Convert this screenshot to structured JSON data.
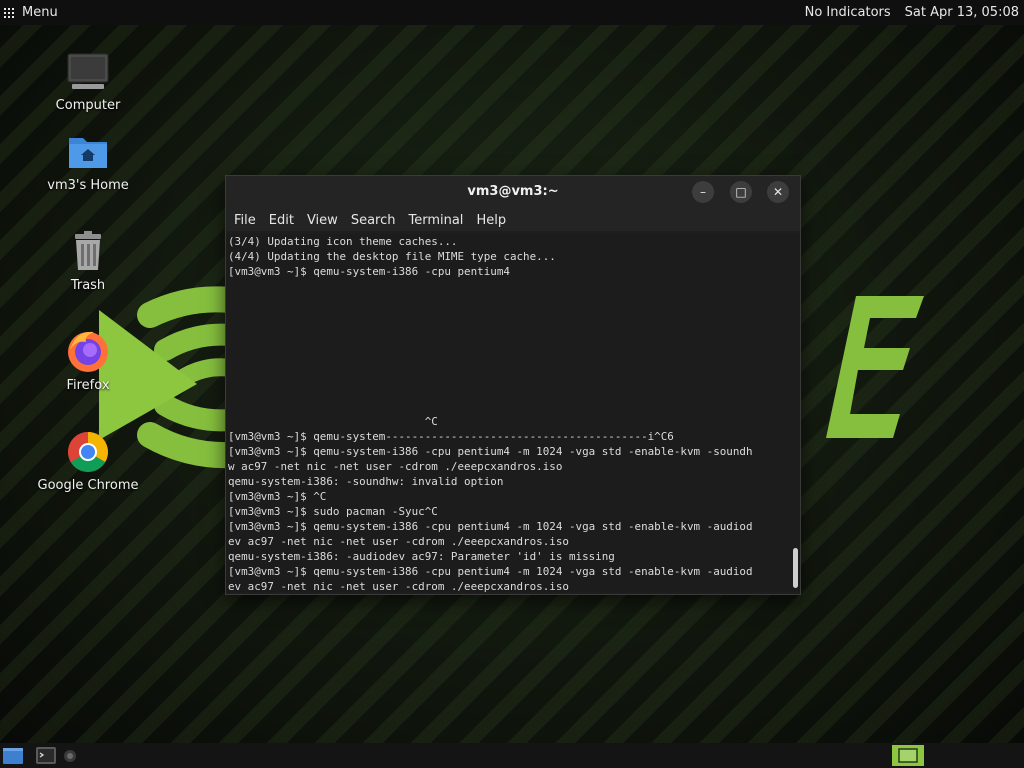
{
  "top_panel": {
    "menu_label": "Menu",
    "indicators": "No Indicators",
    "clock": "Sat Apr 13, 05:08"
  },
  "desktop": {
    "icons": [
      {
        "label": "Computer",
        "icon": "computer-icon"
      },
      {
        "label": "vm3's Home",
        "icon": "home-folder-icon"
      },
      {
        "label": "Trash",
        "icon": "trash-icon"
      },
      {
        "label": "Firefox",
        "icon": "firefox-icon"
      },
      {
        "label": "Google Chrome",
        "icon": "chrome-icon"
      }
    ]
  },
  "terminal": {
    "title": "vm3@vm3:~",
    "controls": {
      "minimize": "–",
      "maximize": "□",
      "close": "✕"
    },
    "menu": [
      "File",
      "Edit",
      "View",
      "Search",
      "Terminal",
      "Help"
    ],
    "lines": [
      "(3/4) Updating icon theme caches...",
      "(4/4) Updating the desktop file MIME type cache...",
      "[vm3@vm3 ~]$ qemu-system-i386 -cpu pentium4",
      "",
      "",
      "",
      "",
      "",
      "",
      "",
      "",
      "",
      "                              ^C",
      "[vm3@vm3 ~]$ qemu-system----------------------------------------i^C6",
      "[vm3@vm3 ~]$ qemu-system-i386 -cpu pentium4 -m 1024 -vga std -enable-kvm -soundh",
      "w ac97 -net nic -net user -cdrom ./eeepcxandros.iso",
      "qemu-system-i386: -soundhw: invalid option",
      "[vm3@vm3 ~]$ ^C",
      "[vm3@vm3 ~]$ sudo pacman -Syuc^C",
      "[vm3@vm3 ~]$ qemu-system-i386 -cpu pentium4 -m 1024 -vga std -enable-kvm -audiod",
      "ev ac97 -net nic -net user -cdrom ./eeepcxandros.iso",
      "qemu-system-i386: -audiodev ac97: Parameter 'id' is missing",
      "[vm3@vm3 ~]$ qemu-system-i386 -cpu pentium4 -m 1024 -vga std -enable-kvm -audiod",
      "ev ac97 -net nic -net user -cdrom ./eeepcxandros.iso"
    ]
  },
  "colors": {
    "accent_green": "#8dc63f",
    "terminal_bg": "#1c1c1c"
  }
}
